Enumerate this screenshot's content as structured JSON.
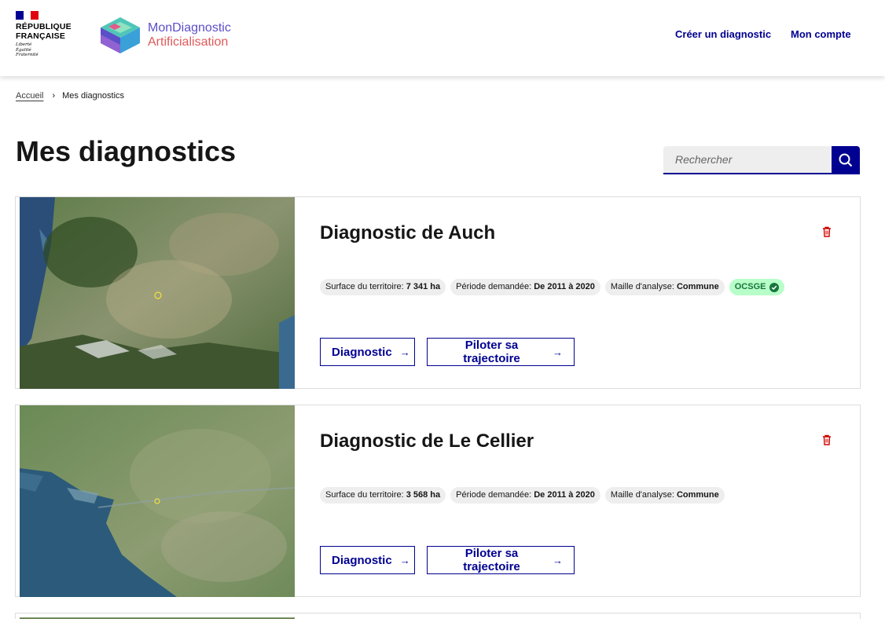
{
  "header": {
    "flag_colors": [
      "#000091",
      "#ffffff",
      "#e1000f"
    ],
    "republic_lines": [
      "RÉPUBLIQUE",
      "FRANÇAISE"
    ],
    "motto_lines": [
      "Liberté",
      "Égalité",
      "Fraternité"
    ],
    "app_name_line1": "MonDiagnostic",
    "app_name_line2": "Artificialisation",
    "nav": {
      "create": "Créer un diagnostic",
      "account": "Mon compte"
    }
  },
  "breadcrumb": {
    "home": "Accueil",
    "current": "Mes diagnostics"
  },
  "page_title": "Mes diagnostics",
  "search": {
    "placeholder": "Rechercher",
    "icon": "search-icon"
  },
  "cards": [
    {
      "title": "Diagnostic de Auch",
      "surface_label": "Surface du territoire:",
      "surface_value": "7 341 ha",
      "period_label": "Période demandée:",
      "period_value": "De 2011 à 2020",
      "mesh_label": "Maille d'analyse:",
      "mesh_value": "Commune",
      "ocsge": "OCSGE",
      "btn_diagnostic": "Diagnostic",
      "btn_pilot": "Piloter sa trajectoire"
    },
    {
      "title": "Diagnostic de Le Cellier",
      "surface_label": "Surface du territoire:",
      "surface_value": "3 568 ha",
      "period_label": "Période demandée:",
      "period_value": "De 2011 à 2020",
      "mesh_label": "Maille d'analyse:",
      "mesh_value": "Commune",
      "btn_diagnostic": "Diagnostic",
      "btn_pilot": "Piloter sa trajectoire"
    }
  ],
  "colors": {
    "primary": "#000091",
    "ocsge_bg": "#b8fec9",
    "ocsge_text": "#18753c",
    "trash": "#ce0500"
  }
}
